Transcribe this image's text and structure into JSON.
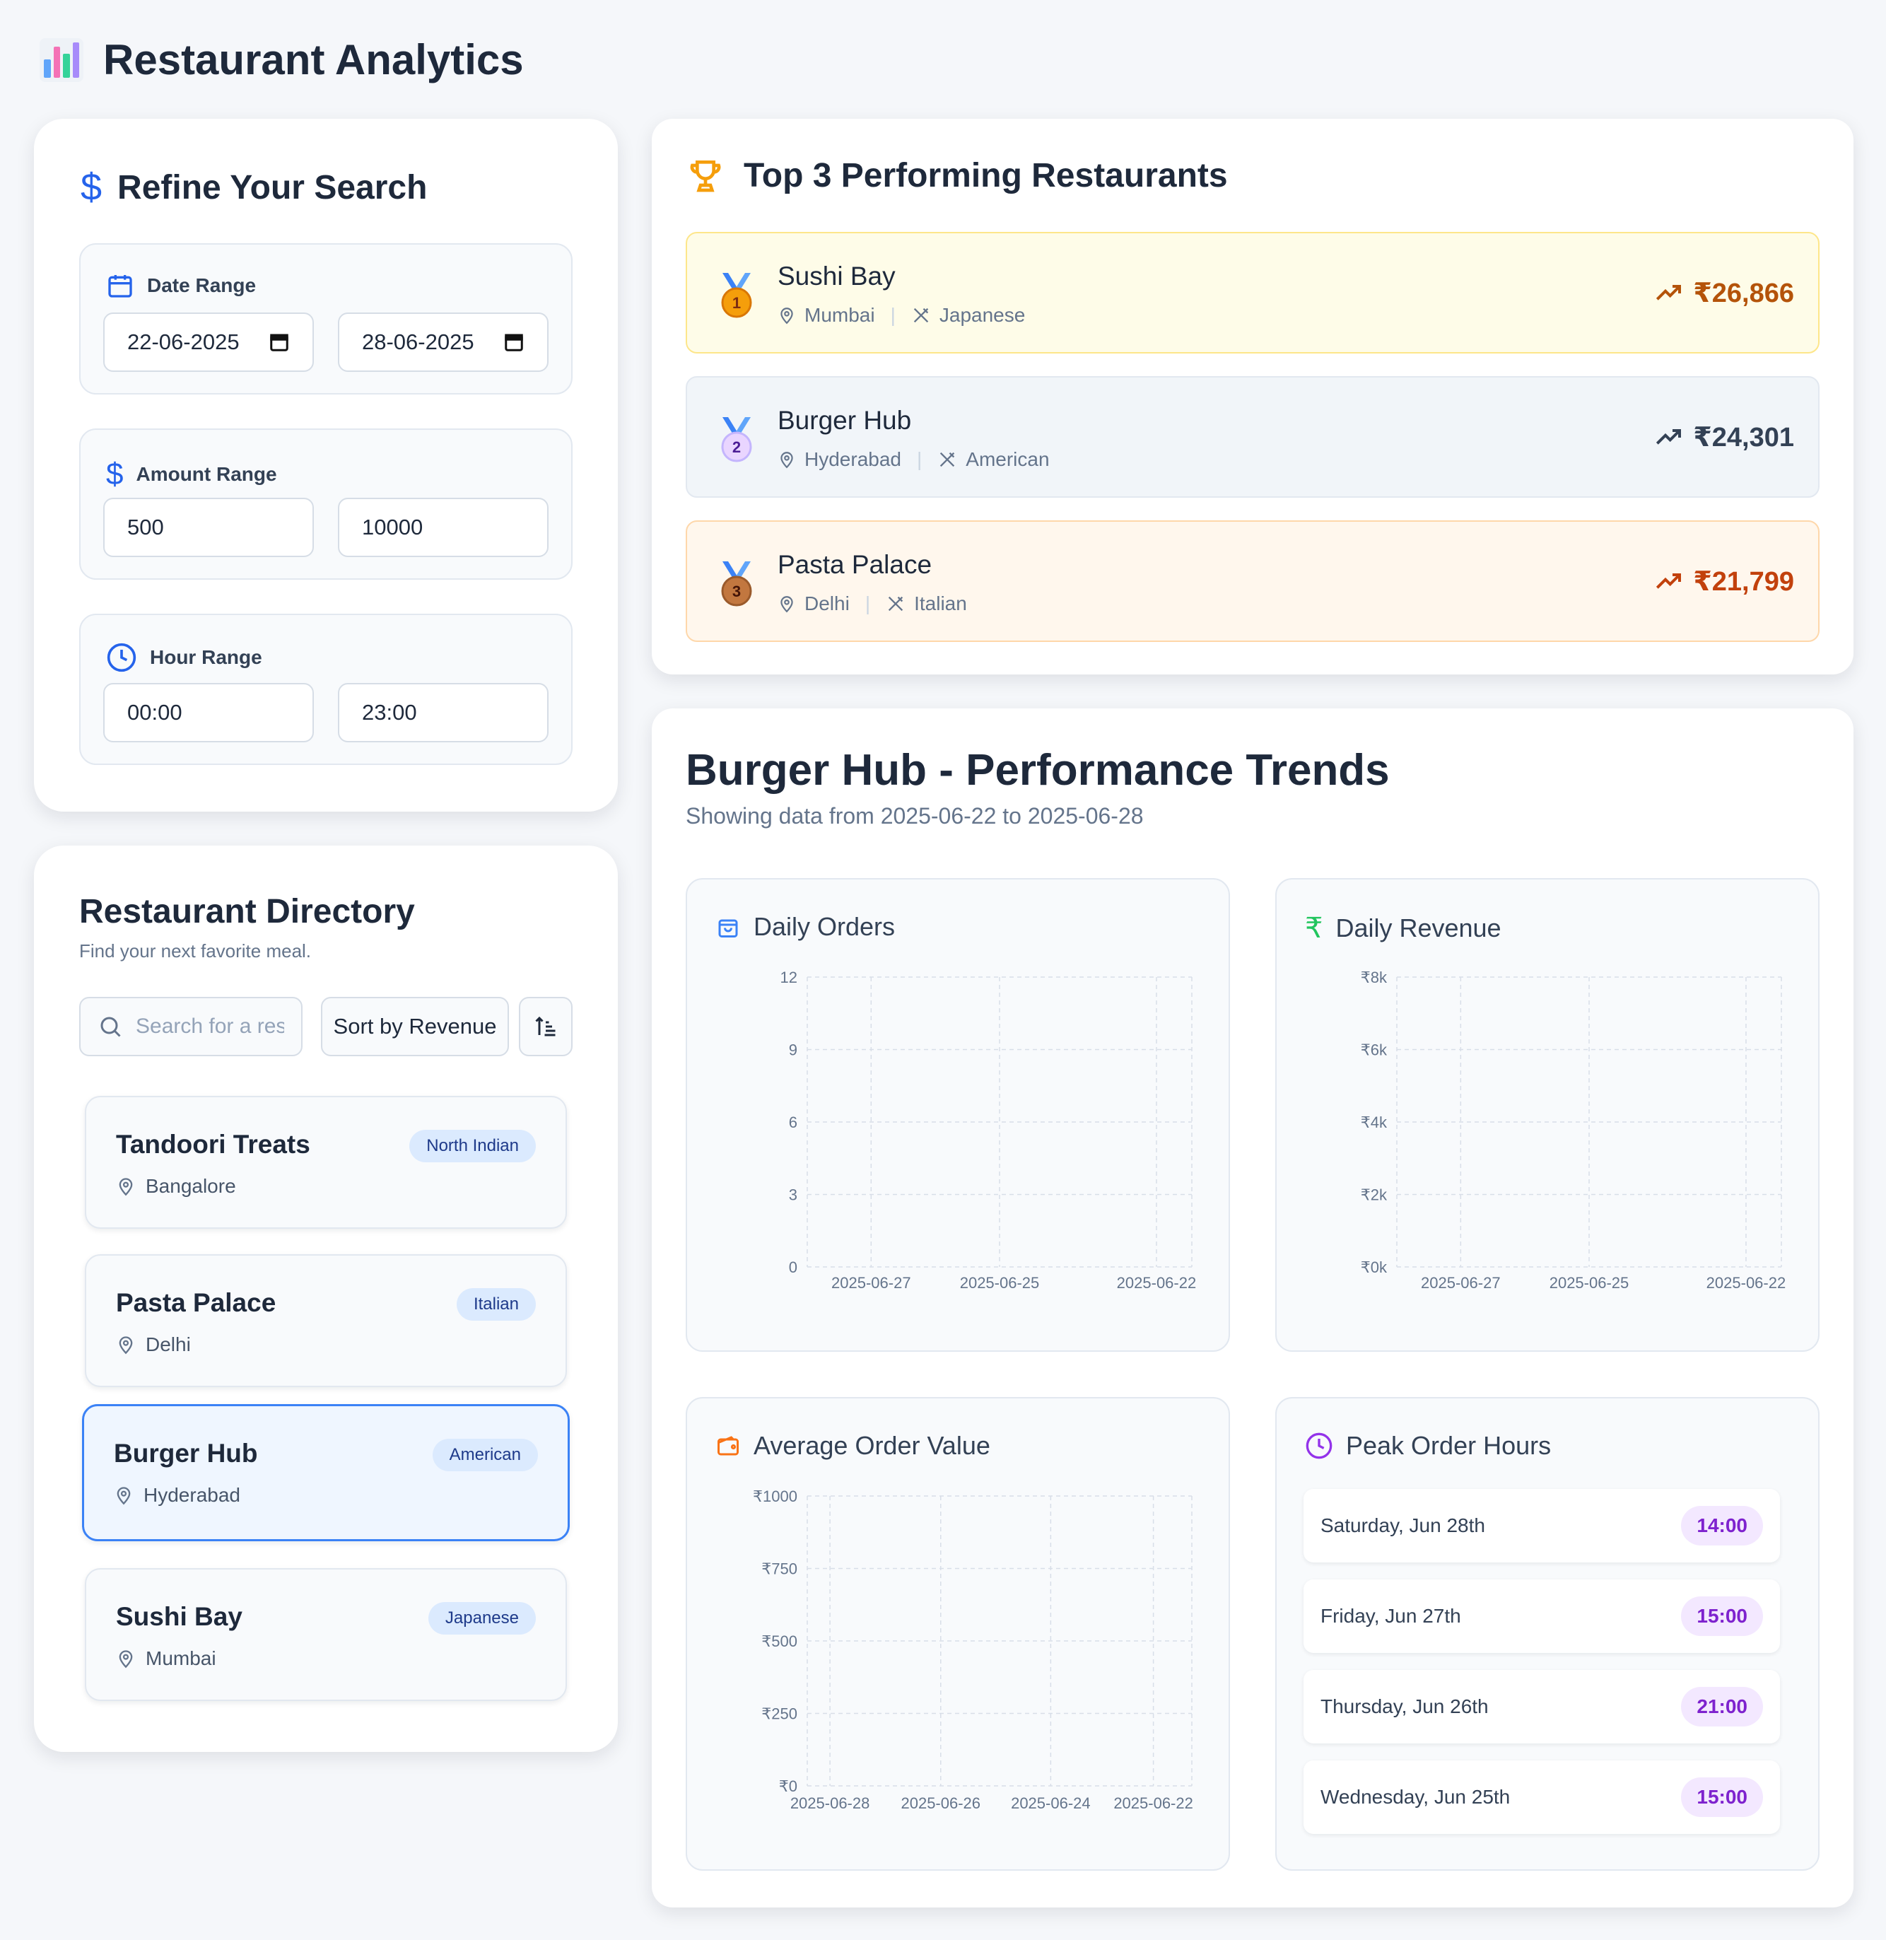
{
  "app": {
    "title": "Restaurant Analytics",
    "logo_icon": "bar-chart-icon"
  },
  "filters": {
    "title": "Refine Your Search",
    "date_range": {
      "label": "Date Range",
      "from": "22-06-2025",
      "to": "28-06-2025"
    },
    "amount_range": {
      "label": "Amount Range",
      "min": "500",
      "max": "10000"
    },
    "hour_range": {
      "label": "Hour Range",
      "from": "00:00",
      "to": "23:00"
    }
  },
  "directory": {
    "title": "Restaurant Directory",
    "subtitle": "Find your next favorite meal.",
    "search_placeholder": "Search for a restaurant",
    "sort_label": "Sort by Revenue",
    "items": [
      {
        "name": "Tandoori Treats",
        "location": "Bangalore",
        "cuisine": "North Indian",
        "selected": false
      },
      {
        "name": "Pasta Palace",
        "location": "Delhi",
        "cuisine": "Italian",
        "selected": false
      },
      {
        "name": "Burger Hub",
        "location": "Hyderabad",
        "cuisine": "American",
        "selected": true
      },
      {
        "name": "Sushi Bay",
        "location": "Mumbai",
        "cuisine": "Japanese",
        "selected": false
      }
    ]
  },
  "top3": {
    "title": "Top 3 Performing Restaurants",
    "items": [
      {
        "rank": "1",
        "name": "Sushi Bay",
        "city": "Mumbai",
        "cuisine": "Japanese",
        "revenue": "₹26,866"
      },
      {
        "rank": "2",
        "name": "Burger Hub",
        "city": "Hyderabad",
        "cuisine": "American",
        "revenue": "₹24,301"
      },
      {
        "rank": "3",
        "name": "Pasta Palace",
        "city": "Delhi",
        "cuisine": "Italian",
        "revenue": "₹21,799"
      }
    ],
    "colors": {
      "gold": "#b45309",
      "silver": "#334155",
      "bronze": "#c2410c"
    }
  },
  "performance": {
    "title": "Burger Hub - Performance Trends",
    "subtitle": "Showing data from 2025-06-22 to 2025-06-28",
    "peak_hours": {
      "title": "Peak Order Hours",
      "rows": [
        {
          "day": "Saturday, Jun 28th",
          "hour": "14:00"
        },
        {
          "day": "Friday, Jun 27th",
          "hour": "15:00"
        },
        {
          "day": "Thursday, Jun 26th",
          "hour": "21:00"
        },
        {
          "day": "Wednesday, Jun 25th",
          "hour": "15:00"
        }
      ]
    }
  },
  "chart_data": [
    {
      "type": "line",
      "title": "Daily Orders",
      "y_ticks": [
        "0",
        "3",
        "6",
        "9",
        "12"
      ],
      "x_tick_labels": [
        "2025-06-27",
        "2025-06-25",
        "2025-06-22"
      ],
      "ylim": [
        0,
        12
      ],
      "grid": true,
      "series": []
    },
    {
      "type": "line",
      "title": "Daily Revenue",
      "y_ticks": [
        "₹0k",
        "₹2k",
        "₹4k",
        "₹6k",
        "₹8k"
      ],
      "x_tick_labels": [
        "2025-06-27",
        "2025-06-25",
        "2025-06-22"
      ],
      "ylim": [
        0,
        8000
      ],
      "grid": true,
      "series": []
    },
    {
      "type": "bar",
      "title": "Average Order Value",
      "y_ticks": [
        "₹0",
        "₹250",
        "₹500",
        "₹750",
        "₹1000"
      ],
      "x_tick_labels": [
        "2025-06-28",
        "2025-06-26",
        "2025-06-24",
        "2025-06-22"
      ],
      "ylim": [
        0,
        1000
      ],
      "grid": true,
      "series": []
    }
  ]
}
